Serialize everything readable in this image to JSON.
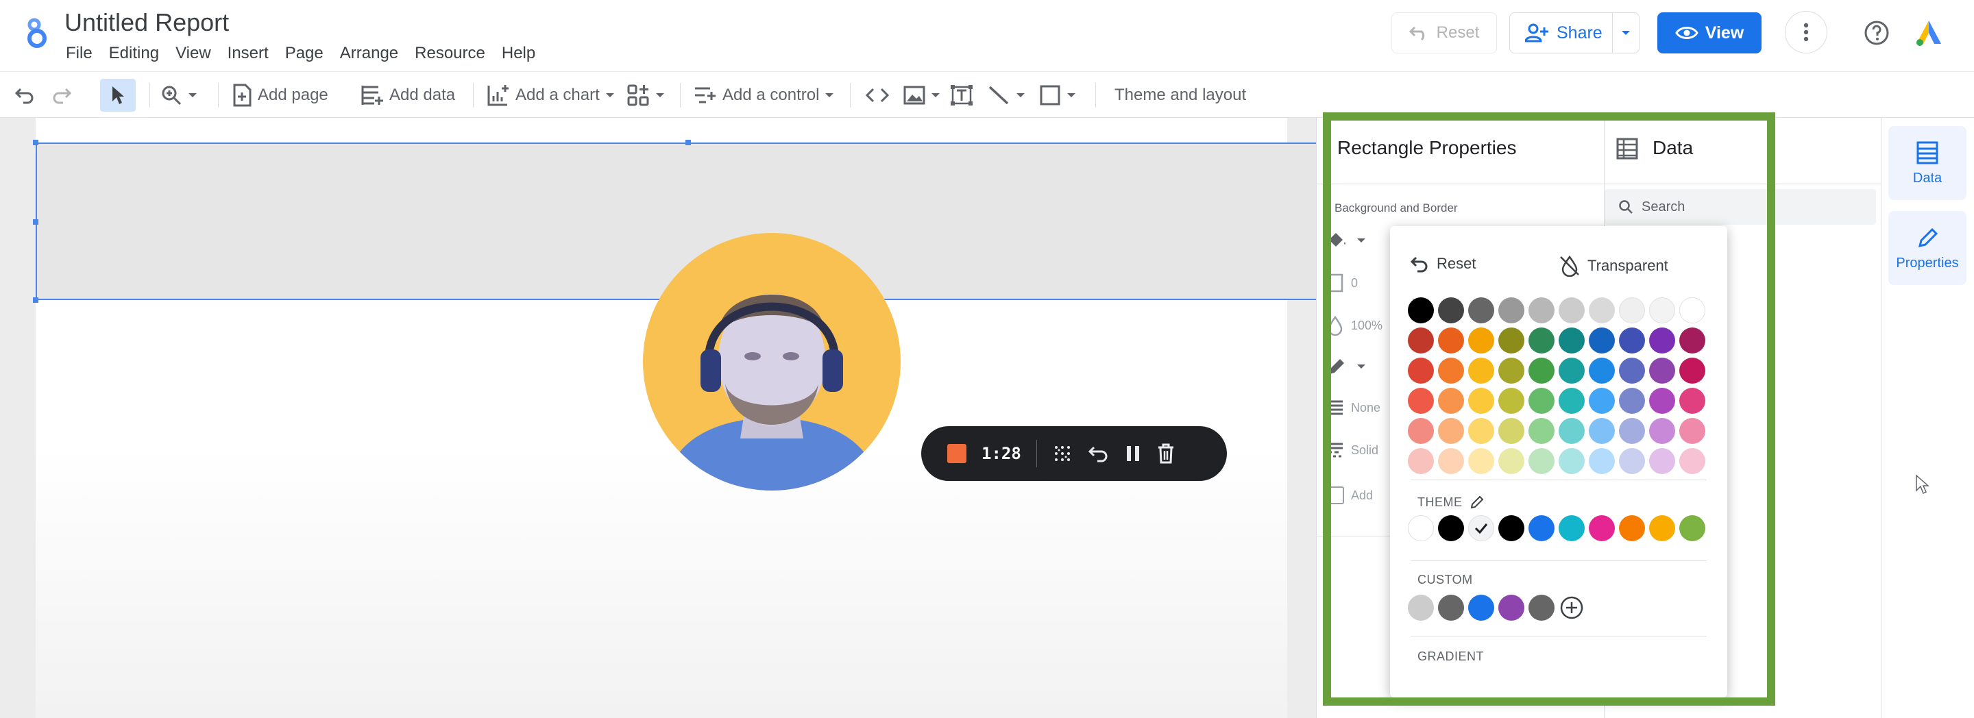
{
  "app": {
    "title": "Untitled Report",
    "menu": [
      "File",
      "Editing",
      "View",
      "Insert",
      "Page",
      "Arrange",
      "Resource",
      "Help"
    ],
    "reset_label": "Reset",
    "share_label": "Share",
    "view_label": "View"
  },
  "toolbar": {
    "add_page": "Add page",
    "add_data": "Add data",
    "add_chart": "Add a chart",
    "add_control": "Add a control",
    "theme_layout": "Theme and layout"
  },
  "recording": {
    "time": "1:28",
    "stop_color": "#f26b3a"
  },
  "properties_panel": {
    "title": "Rectangle Properties",
    "section": "Background and Border",
    "border_weight": "0",
    "opacity": "100%",
    "line_style": "None",
    "border_style": "Solid",
    "shadow_label": "Add"
  },
  "data_panel": {
    "title": "Data",
    "search_placeholder": "Search"
  },
  "side_rail": {
    "data_label": "Data",
    "properties_label": "Properties"
  },
  "color_picker": {
    "reset_label": "Reset",
    "transparent_label": "Transparent",
    "theme_label": "THEME",
    "custom_label": "CUSTOM",
    "gradient_label": "GRADIENT",
    "grays": [
      "#000000",
      "#434343",
      "#666666",
      "#999999",
      "#b7b7b7",
      "#cccccc",
      "#d9d9d9",
      "#efefef",
      "#f3f3f3",
      "#ffffff"
    ],
    "palette_rows": [
      [
        "#c0392b",
        "#e8601c",
        "#f4a300",
        "#8c8c1a",
        "#2e8b57",
        "#138686",
        "#1565c0",
        "#3f51b5",
        "#7b2fb5",
        "#a31d5c"
      ],
      [
        "#dd4433",
        "#f27a2a",
        "#f9b81a",
        "#a5a52a",
        "#43a047",
        "#1a9e9e",
        "#1e88e5",
        "#5c6bc0",
        "#8e44ad",
        "#c2185b"
      ],
      [
        "#ef5a48",
        "#f7934a",
        "#fbc83a",
        "#bdbd3a",
        "#66bb6a",
        "#26b5b5",
        "#42a5f5",
        "#7986cb",
        "#ab47bc",
        "#e04080"
      ],
      [
        "#f28b82",
        "#fbb07a",
        "#fdd66a",
        "#d4d46a",
        "#8fd18f",
        "#6dd0d0",
        "#7fc1f7",
        "#a3addf",
        "#c88ad8",
        "#f08aab"
      ],
      [
        "#f8c1bb",
        "#fdd3b3",
        "#fee7a6",
        "#e9e9a6",
        "#bde5bd",
        "#a8e4e4",
        "#b3dbfb",
        "#c9cfee",
        "#e1bfea",
        "#f7c3d4"
      ]
    ],
    "theme_colors": [
      "#ffffff",
      "#000000",
      "#f1f3f4",
      "#000000",
      "#1a73e8",
      "#12b5cb",
      "#e52592",
      "#f57c00",
      "#f9ab00",
      "#7cb342"
    ],
    "custom_colors": [
      "#cccccc",
      "#666666",
      "#1a73e8",
      "#8e44ad",
      "#666666"
    ]
  },
  "colors": {
    "accent": "#1a73e8",
    "highlight": "#6aa03c",
    "selection": "#4a86e8"
  }
}
